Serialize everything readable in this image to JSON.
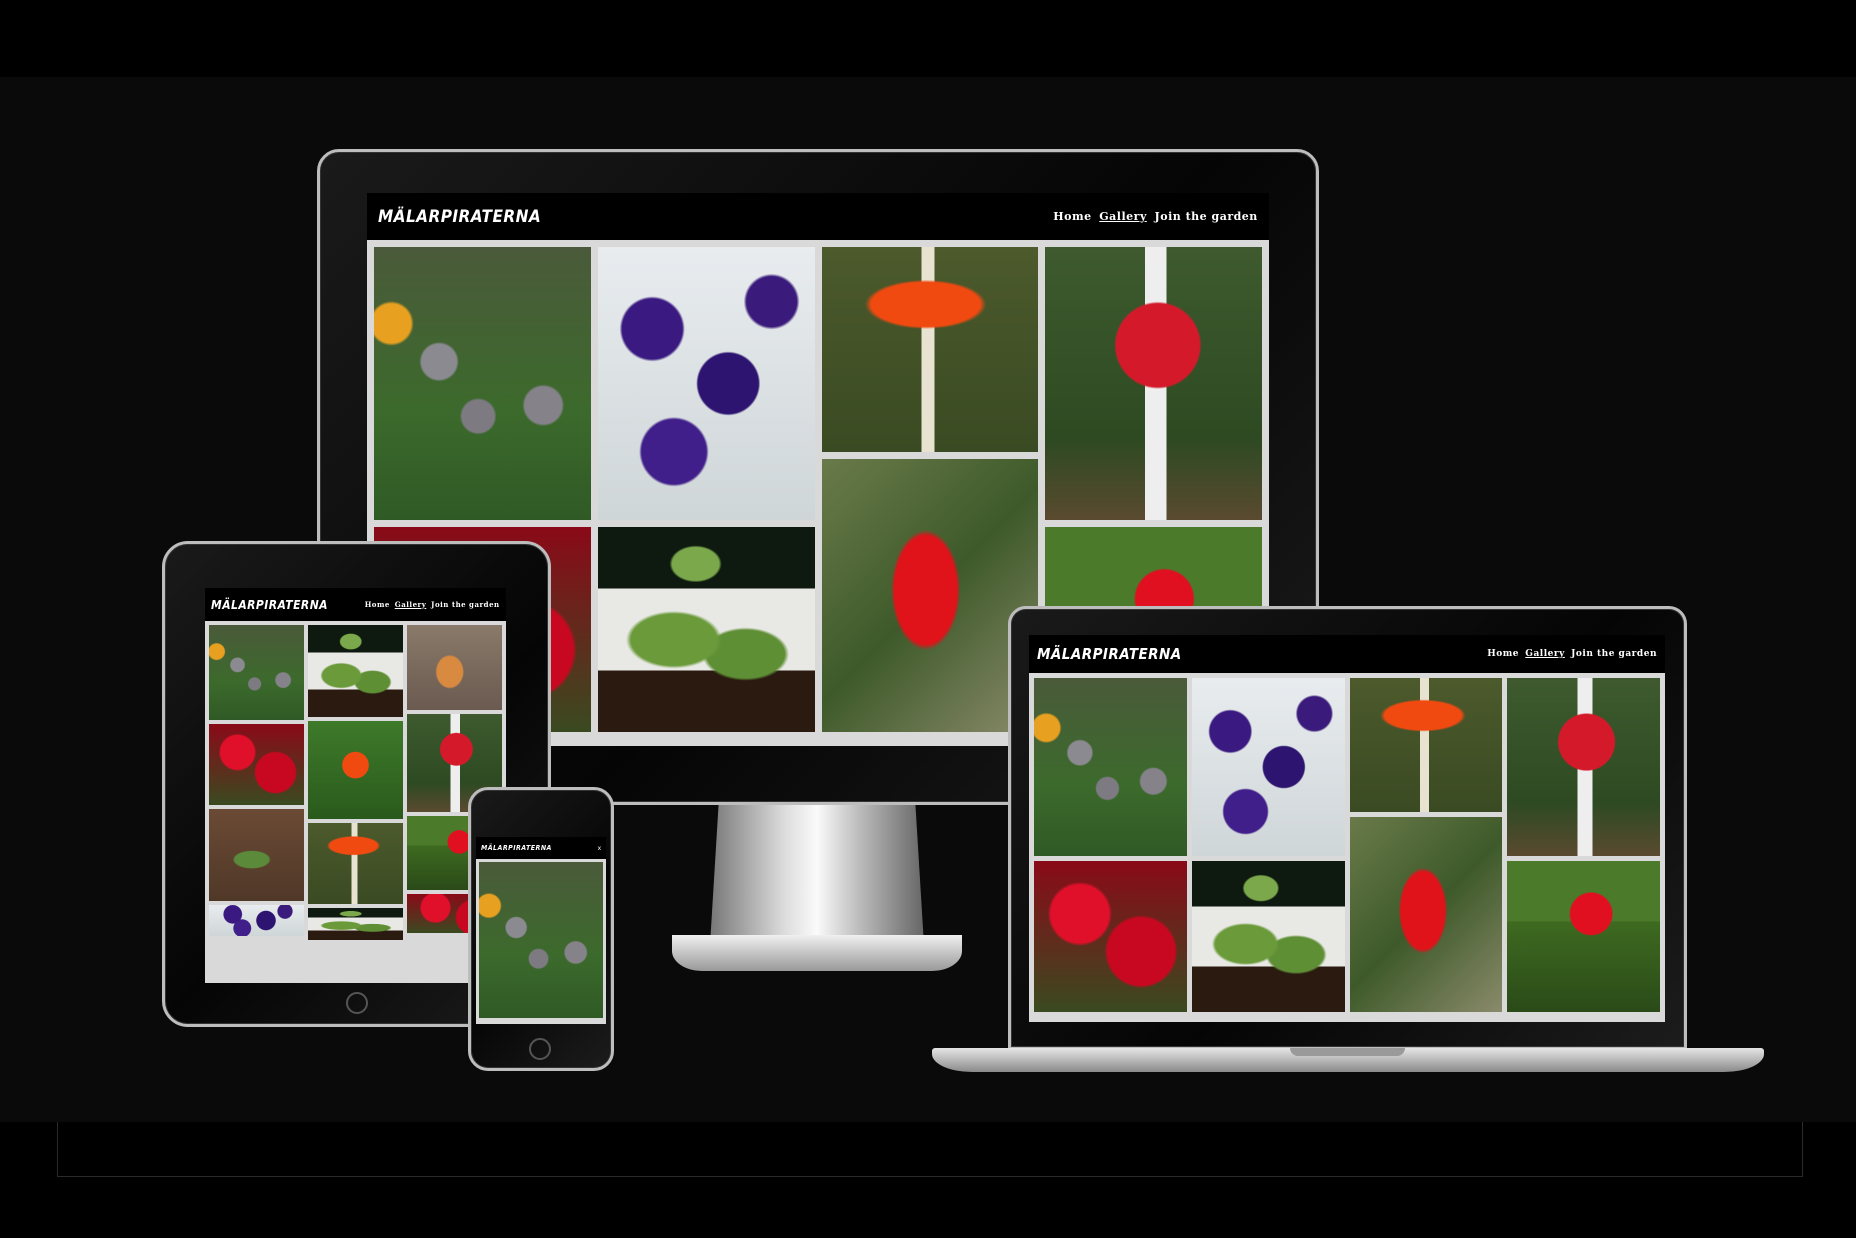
{
  "site": {
    "brand": "MÄLARPIRATERNA",
    "nav": [
      "Home",
      "Gallery",
      "Join the garden"
    ],
    "active_nav": "Gallery",
    "mobile_close": "x"
  },
  "colors": {
    "header_bg": "#000000",
    "page_bg": "#0a0a0a",
    "gallery_gap": "#d9d9d9"
  }
}
